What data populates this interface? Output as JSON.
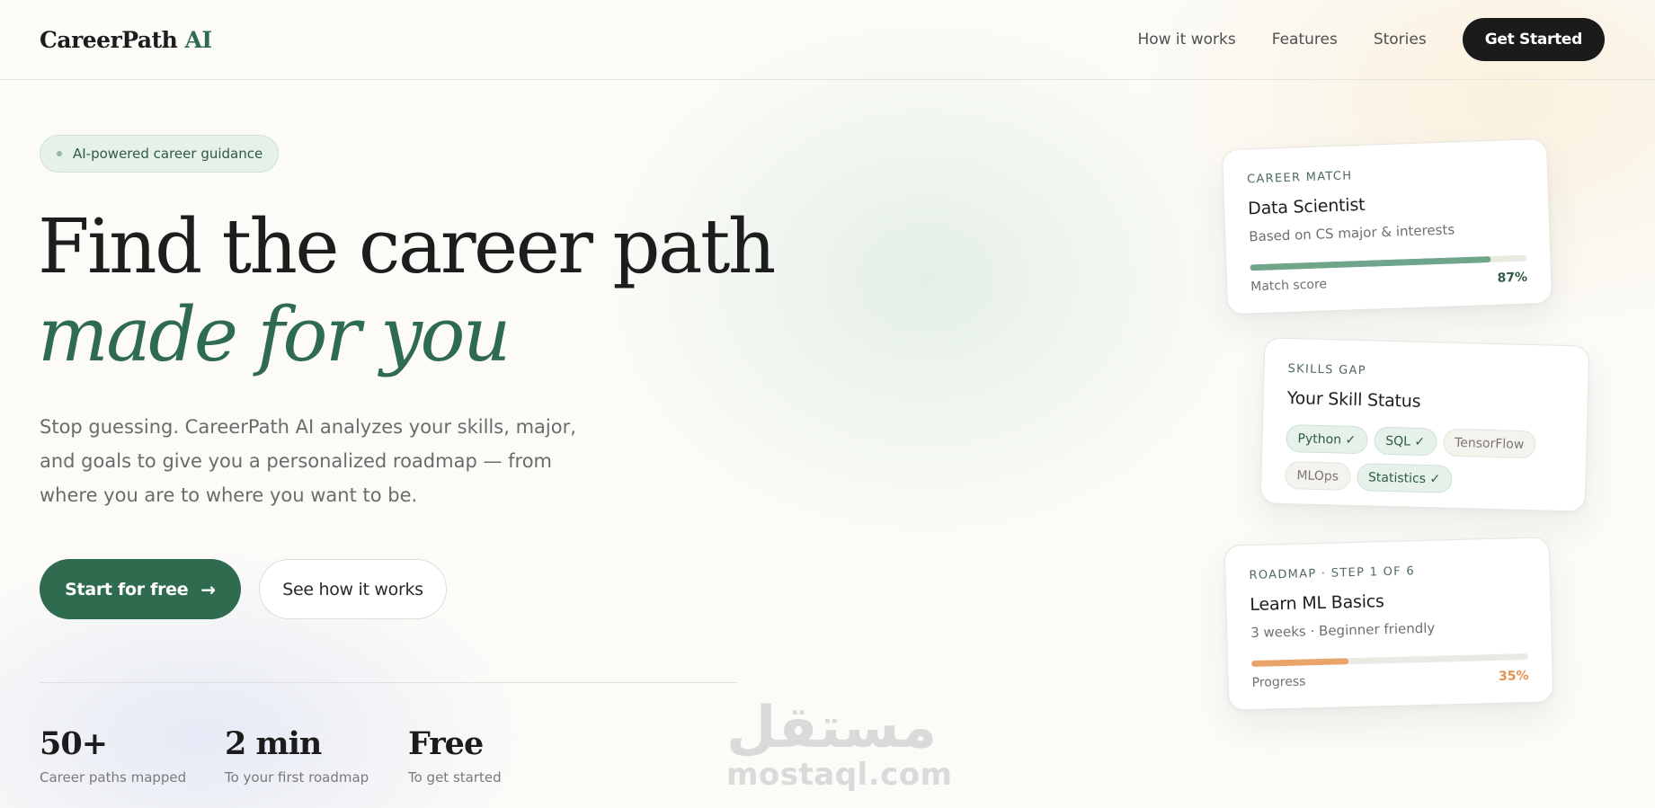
{
  "nav": {
    "logo_main": "CareerPath",
    "logo_accent": "AI",
    "links": [
      "How it works",
      "Features",
      "Stories"
    ],
    "cta": "Get Started"
  },
  "hero": {
    "badge": "AI-powered career guidance",
    "headline_line1": "Find the career path",
    "headline_line2": "made for you",
    "subtext": "Stop guessing. CareerPath AI analyzes your skills, major, and goals to give you a personalized roadmap — from where you are to where you want to be.",
    "primary_button": "Start for free",
    "primary_button_icon": "arrow-right-icon",
    "secondary_button": "See how it works"
  },
  "stats": [
    {
      "value": "50+",
      "label": "Career paths mapped"
    },
    {
      "value": "2 min",
      "label": "To your first roadmap"
    },
    {
      "value": "Free",
      "label": "To get started"
    }
  ],
  "cards": {
    "match": {
      "eyebrow": "CAREER MATCH",
      "title": "Data Scientist",
      "meta": "Based on CS major & interests",
      "bar_label": "Match score",
      "bar_value_text": "87%",
      "bar_value": 87,
      "bar_color": "#6fa58a",
      "value_color": "#2f5a45"
    },
    "skills": {
      "eyebrow": "SKILLS GAP",
      "title": "Your Skill Status",
      "chips": [
        {
          "label": "Python ✓",
          "done": true
        },
        {
          "label": "SQL ✓",
          "done": true
        },
        {
          "label": "TensorFlow",
          "done": false
        },
        {
          "label": "MLOps",
          "done": false
        },
        {
          "label": "Statistics ✓",
          "done": true
        }
      ]
    },
    "roadmap": {
      "eyebrow": "ROADMAP · STEP 1 OF 6",
      "title": "Learn ML Basics",
      "meta": "3 weeks · Beginner friendly",
      "bar_label": "Progress",
      "bar_value_text": "35%",
      "bar_value": 35,
      "bar_color": "#e9a46a",
      "value_color": "#e0914f"
    }
  },
  "watermark": {
    "arabic": "مستقل",
    "latin": "mostaql.com"
  },
  "colors": {
    "accent": "#2f6b4f",
    "dark": "#1b1b1b"
  }
}
